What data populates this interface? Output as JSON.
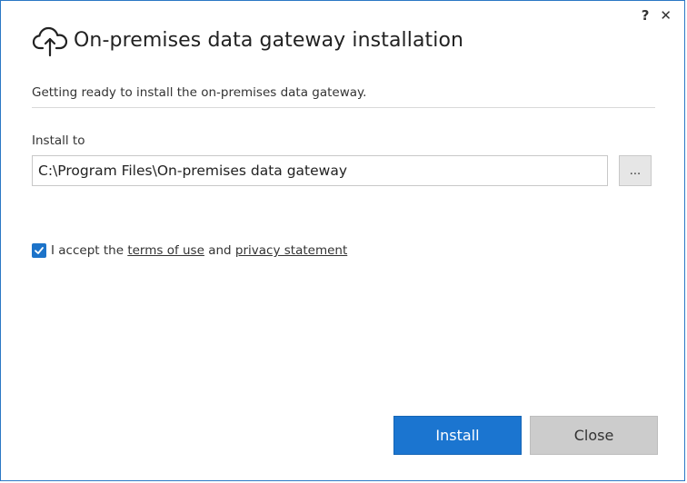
{
  "window": {
    "help_button": "?",
    "close_button": "✕"
  },
  "header": {
    "icon": "cloud-upload-icon",
    "title": "On-premises data gateway installation"
  },
  "main": {
    "status_text": "Getting ready to install the on-premises data gateway.",
    "install_to_label": "Install to",
    "install_path_value": "C:\\Program Files\\On-premises data gateway",
    "browse_button": "...",
    "accept": {
      "checked": true,
      "prefix": "I accept the",
      "terms_link": "terms of use",
      "and_text": "and",
      "privacy_link": "privacy statement"
    }
  },
  "footer": {
    "install_button": "Install",
    "close_button": "Close"
  },
  "colors": {
    "accent": "#1b75d0",
    "checkbox": "#1c73c9",
    "secondary_button": "#cccccc",
    "window_border": "#2b78c5"
  }
}
